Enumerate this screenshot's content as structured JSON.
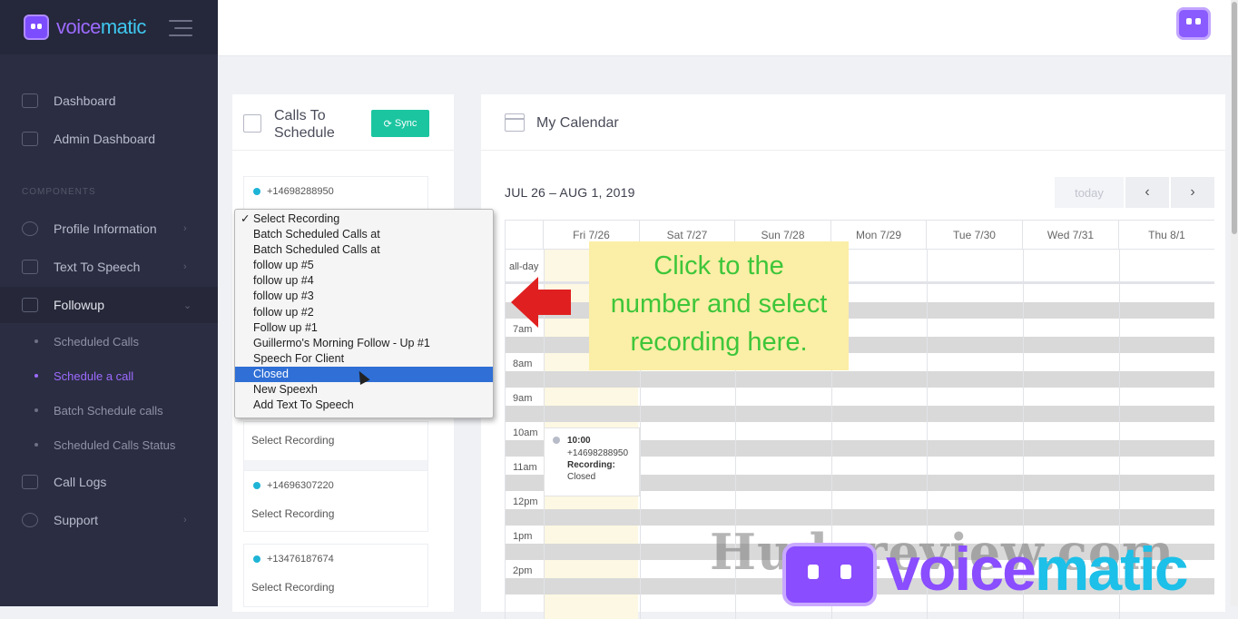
{
  "brand": {
    "part1": "voice",
    "part2": "matic"
  },
  "sidebar": {
    "items": [
      {
        "label": "Dashboard"
      },
      {
        "label": "Admin Dashboard"
      },
      {
        "label": "Profile Information"
      },
      {
        "label": "Text To Speech"
      },
      {
        "label": "Followup"
      },
      {
        "label": "Call Logs"
      },
      {
        "label": "Support"
      }
    ],
    "section_label": "COMPONENTS",
    "sub_items": [
      {
        "label": "Scheduled Calls"
      },
      {
        "label": "Schedule a call"
      },
      {
        "label": "Batch Schedule calls"
      },
      {
        "label": "Scheduled Calls Status"
      }
    ]
  },
  "calls_panel": {
    "title": "Calls To Schedule",
    "sync_label": "Sync",
    "cards": [
      {
        "number": "+14698288950",
        "select": "Select Recording"
      },
      {
        "number": "+14696307220",
        "select": "Select Recording"
      },
      {
        "number": "+13476187674",
        "select": "Select Recording"
      }
    ],
    "hidden_select": "Select Recording"
  },
  "dropdown": {
    "options": [
      "Select Recording",
      "Batch Scheduled Calls at",
      "Batch Scheduled Calls at",
      "follow up #5",
      "follow up #4",
      "follow up #3",
      "follow up #2",
      "Follow up #1",
      "Guillermo's Morning Follow - Up #1",
      "Speech For Client",
      "Closed",
      "New Speexh",
      "Add Text To Speech"
    ],
    "checked_index": 0,
    "highlighted_index": 10
  },
  "calendar": {
    "title": "My Calendar",
    "range": "JUL 26 – AUG 1, 2019",
    "today_label": "today",
    "prev_label": "‹",
    "next_label": "›",
    "allday_label": "all-day",
    "days": [
      "Fri 7/26",
      "Sat 7/27",
      "Sun 7/28",
      "Mon 7/29",
      "Tue 7/30",
      "Wed 7/31",
      "Thu 8/1"
    ],
    "hours": [
      "7am",
      "8am",
      "9am",
      "10am",
      "11am",
      "12pm",
      "1pm",
      "2pm"
    ],
    "event": {
      "time": "10:00",
      "number": "+14698288950",
      "recording_label": "Recording:",
      "recording_value": "Closed"
    }
  },
  "callout": {
    "line1": "Click to the",
    "line2": "number and select",
    "line3": "recording here."
  },
  "watermark": {
    "site": "Hudareview.com",
    "name_part1": "voice",
    "name_part2": "matic"
  },
  "colors": {
    "sidebar_bg": "#2b2d42",
    "accent_purple": "#9c6bff",
    "sync_green": "#1bc5a0",
    "callout_bg": "#fbeea6",
    "callout_text": "#3ec63a",
    "arrow_red": "#e02020",
    "highlight_blue": "#2f6fd6"
  }
}
